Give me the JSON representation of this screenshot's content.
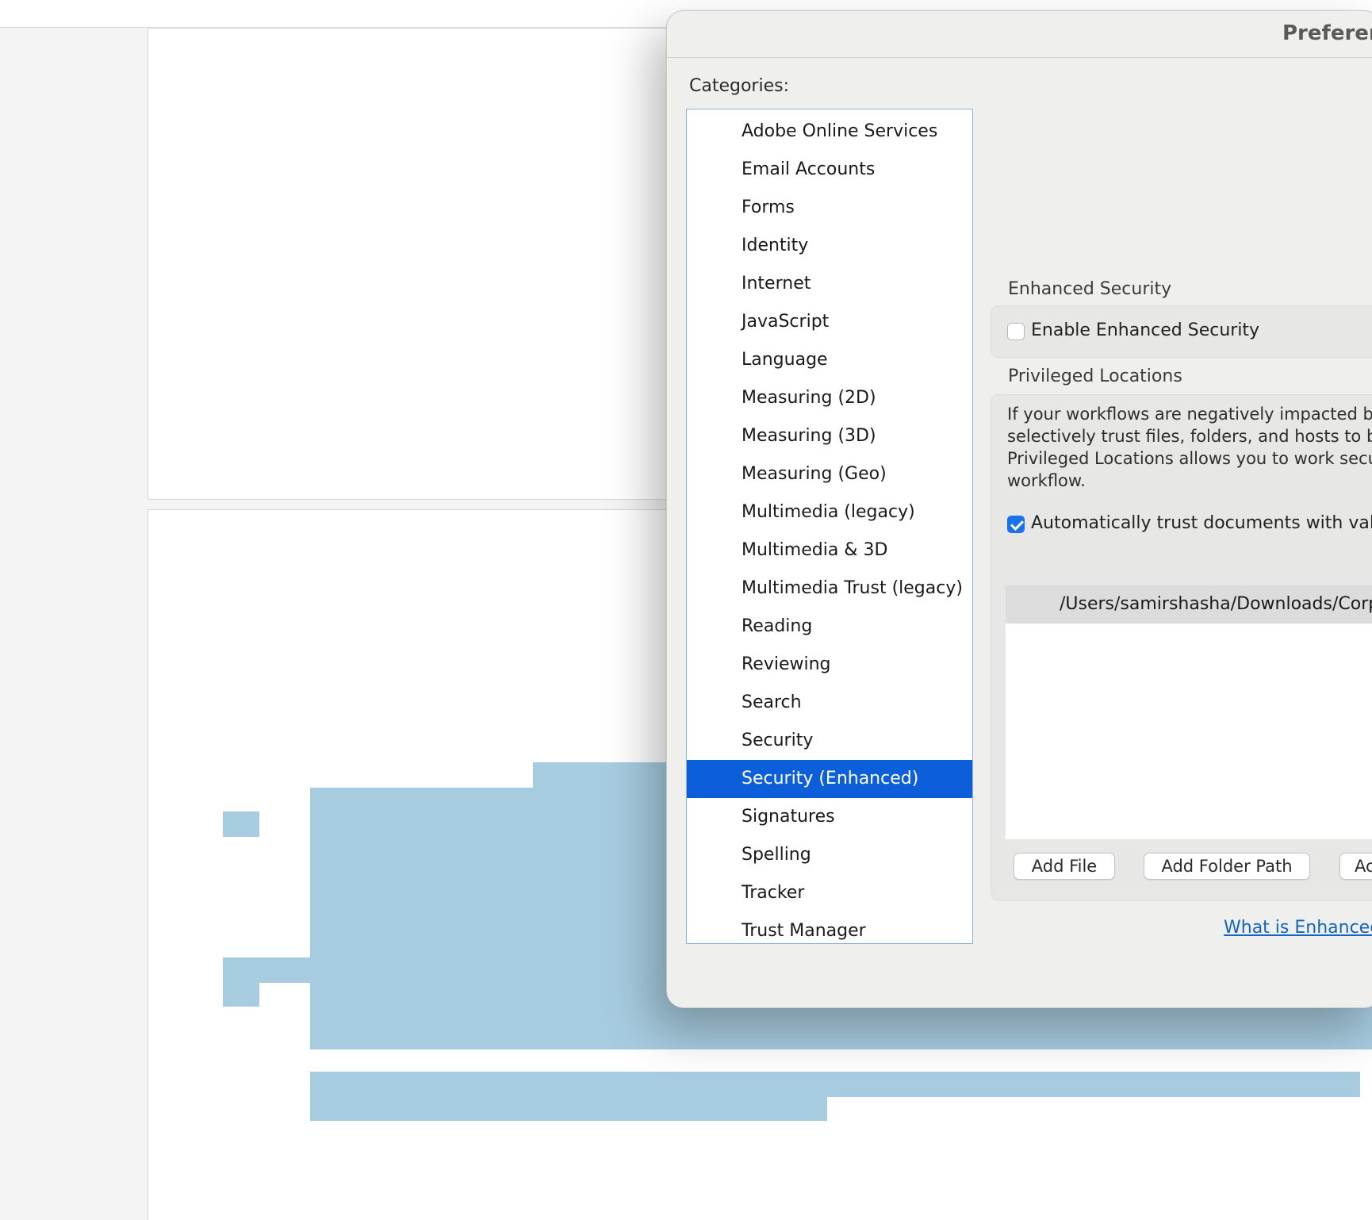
{
  "dialog": {
    "title": "Preferences",
    "categories_label": "Categories:",
    "categories": [
      "Adobe Online Services",
      "Email Accounts",
      "Forms",
      "Identity",
      "Internet",
      "JavaScript",
      "Language",
      "Measuring (2D)",
      "Measuring (3D)",
      "Measuring (Geo)",
      "Multimedia (legacy)",
      "Multimedia & 3D",
      "Multimedia Trust (legacy)",
      "Reading",
      "Reviewing",
      "Search",
      "Security",
      "Security (Enhanced)",
      "Signatures",
      "Spelling",
      "Tracker",
      "Trust Manager"
    ],
    "selected_category": "Security (Enhanced)",
    "enhanced_security": {
      "heading": "Enhanced Security",
      "enable_label": "Enable Enhanced Security",
      "enabled": false
    },
    "privileged_locations": {
      "heading": "Privileged Locations",
      "description_lines": [
        "If your workflows are negatively impacted by",
        "selectively trust files, folders, and hosts to b",
        "Privileged Locations allows you to work secu",
        "workflow."
      ],
      "auto_trust_label": "Automatically trust documents with valid",
      "auto_trust_checked": true,
      "locations": [
        "/Users/samirshasha/Downloads/Corp"
      ],
      "buttons": {
        "add_file": "Add File",
        "add_folder_path": "Add Folder Path",
        "add_host": "Ac"
      }
    },
    "help_link": "What is Enhanced"
  }
}
